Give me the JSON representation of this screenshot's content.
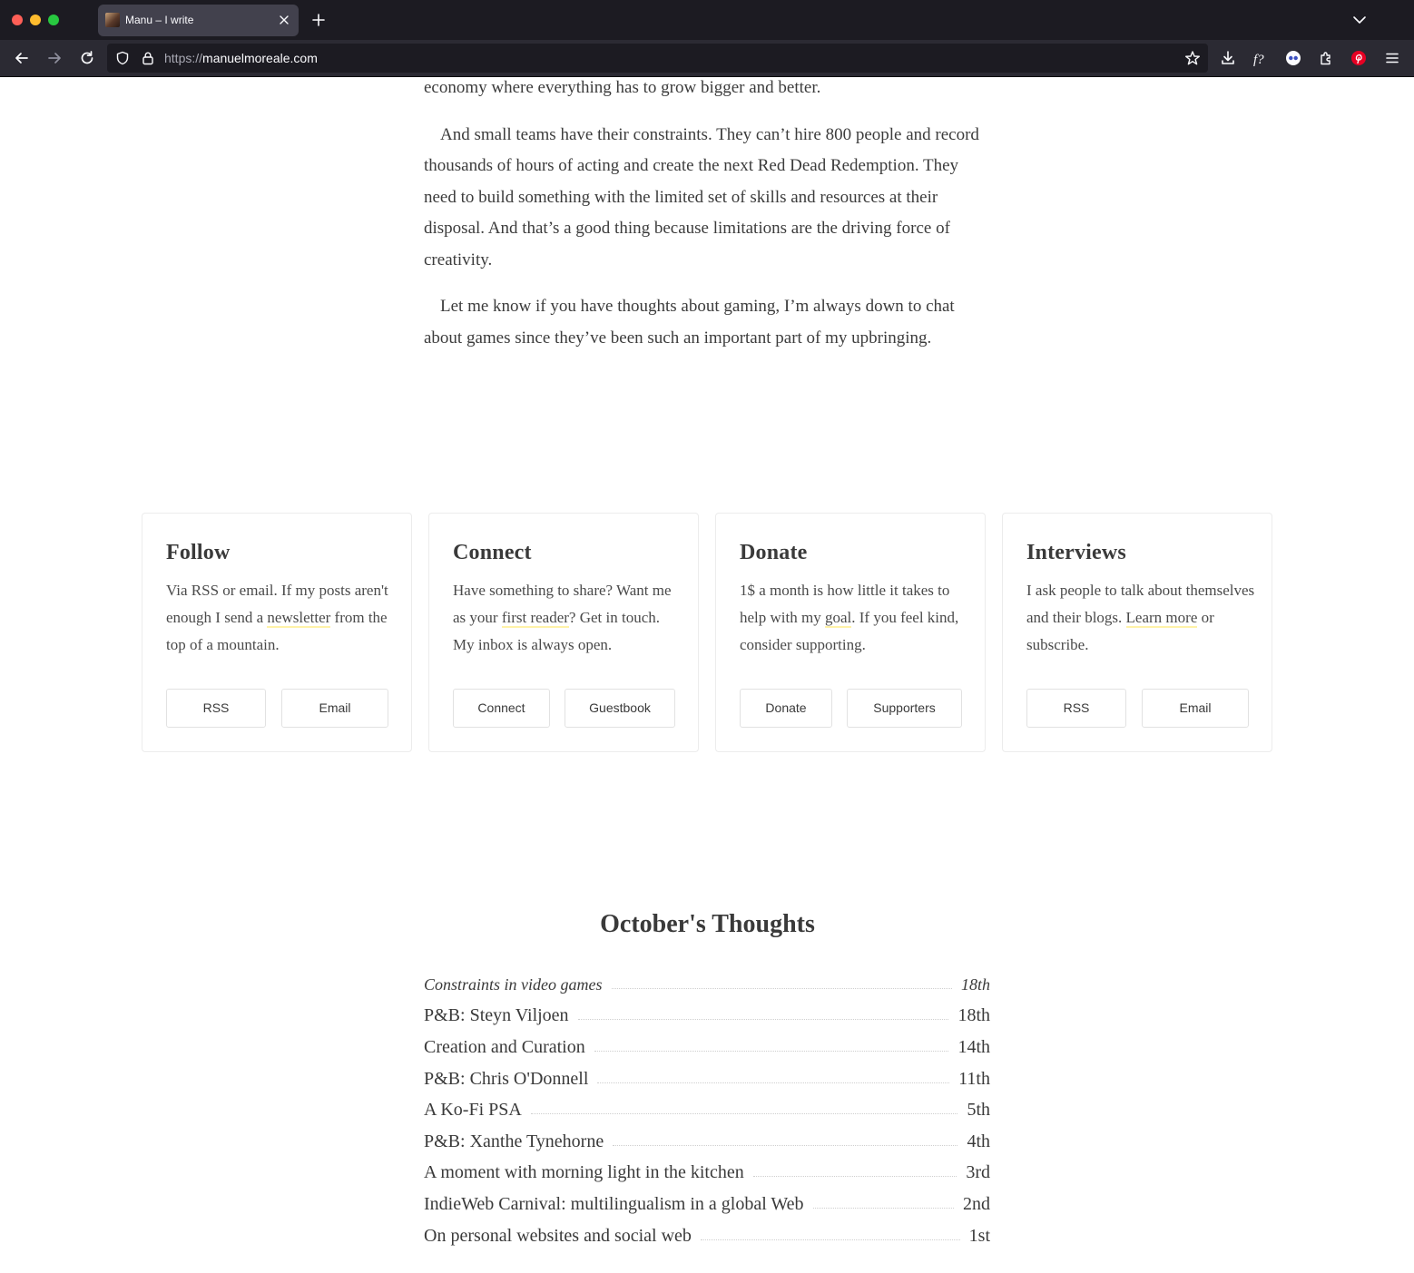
{
  "browser": {
    "tab": {
      "title": "Manu – I write"
    },
    "url": {
      "protocol": "https://",
      "host": "manuelmoreale.com"
    }
  },
  "article": {
    "paragraphs": [
      "economy where everything has to grow bigger and better.",
      "And small teams have their constraints. They can’t hire 800 people and record thousands of hours of acting and create the next Red Dead Redemption. They need to build something with the limited set of skills and resources at their disposal. And that’s a good thing because limitations are the driving force of creativity.",
      "Let me know if you have thoughts about gaming, I’m always down to chat about games since they’ve been such an important part of my upbringing."
    ]
  },
  "cards": {
    "follow": {
      "title": "Follow",
      "text_before": "Via RSS or email. If my posts aren't enough I send a ",
      "link": "newsletter",
      "text_after": " from the top of a mountain.",
      "buttons": [
        "RSS",
        "Email"
      ]
    },
    "connect": {
      "title": "Connect",
      "text_before": "Have something to share? Want me as your ",
      "link": "first reader",
      "text_after": "? Get in touch. My inbox is always open.",
      "buttons": [
        "Connect",
        "Guestbook"
      ]
    },
    "donate": {
      "title": "Donate",
      "text_before": "1$ a month is how little it takes to help with my ",
      "link": "goal",
      "text_after": ". If you feel kind, consider supporting.",
      "buttons": [
        "Donate",
        "Supporters"
      ]
    },
    "interviews": {
      "title": "Interviews",
      "text_before": "I ask people to talk about themselves and their blogs. ",
      "link": "Learn more",
      "text_after": " or subscribe.",
      "buttons": [
        "RSS",
        "Email"
      ]
    }
  },
  "thoughts": {
    "title": "October's Thoughts",
    "items": [
      {
        "title": "Constraints in video games",
        "day": "18th",
        "current": true
      },
      {
        "title": "P&B: Steyn Viljoen",
        "day": "18th"
      },
      {
        "title": "Creation and Curation",
        "day": "14th"
      },
      {
        "title": "P&B: Chris O'Donnell",
        "day": "11th"
      },
      {
        "title": "A Ko-Fi PSA",
        "day": "5th"
      },
      {
        "title": "P&B: Xanthe Tynehorne",
        "day": "4th"
      },
      {
        "title": "A moment with morning light in the kitchen",
        "day": "3rd"
      },
      {
        "title": "IndieWeb Carnival: multilingualism in a global Web",
        "day": "2nd"
      },
      {
        "title": "On personal websites and social web",
        "day": "1st"
      }
    ]
  }
}
